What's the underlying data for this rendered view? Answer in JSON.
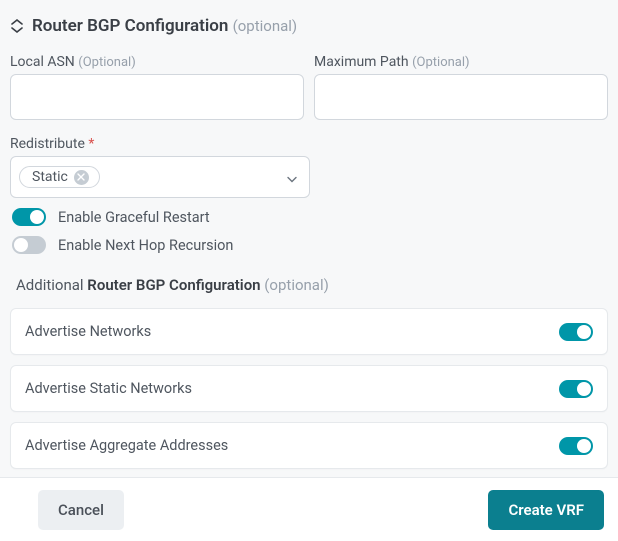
{
  "section": {
    "title": "Router BGP Configuration",
    "optional_suffix": "(optional)"
  },
  "fields": {
    "local_asn": {
      "label": "Local ASN",
      "optional_suffix": "(Optional)",
      "value": ""
    },
    "maximum_path": {
      "label": "Maximum Path",
      "optional_suffix": "(Optional)",
      "value": ""
    },
    "redistribute": {
      "label": "Redistribute",
      "required_marker": "*",
      "chip_label": "Static"
    }
  },
  "toggles": {
    "graceful_restart": {
      "label": "Enable Graceful Restart",
      "on": true
    },
    "next_hop_recursion": {
      "label": "Enable Next Hop Recursion",
      "on": false
    }
  },
  "subsection": {
    "prefix": "Additional",
    "strong": "Router BGP Configuration",
    "optional_suffix": "(optional)"
  },
  "rows": [
    {
      "label": "Advertise Networks",
      "on": true
    },
    {
      "label": "Advertise Static Networks",
      "on": true
    },
    {
      "label": "Advertise Aggregate Addresses",
      "on": true
    }
  ],
  "footer": {
    "cancel": "Cancel",
    "submit": "Create VRF"
  }
}
